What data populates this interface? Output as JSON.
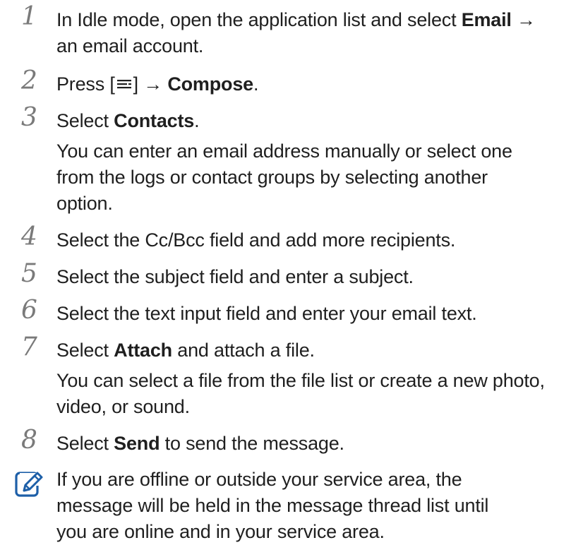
{
  "steps": [
    {
      "number": "1",
      "lines": [
        [
          "In Idle mode, open the application list and select ",
          "Email",
          " →"
        ],
        [
          "an email account."
        ]
      ]
    },
    {
      "number": "2",
      "parts": [
        "Press [",
        "menu-key-icon",
        "] → ",
        "Compose",
        "."
      ]
    },
    {
      "number": "3",
      "title_pre": "Select ",
      "title_bold": "Contacts",
      "title_post": ".",
      "detail": [
        "You can enter an email address manually or select one",
        "from the logs or contact groups by selecting another",
        "option."
      ]
    },
    {
      "number": "4",
      "text": "Select the Cc/Bcc field and add more recipients."
    },
    {
      "number": "5",
      "text": "Select the subject field and enter a subject."
    },
    {
      "number": "6",
      "text": "Select the text input field and enter your email text."
    },
    {
      "number": "7",
      "title_pre": "Select ",
      "title_bold": "Attach",
      "title_post": " and attach a file.",
      "detail": [
        "You can select a file from the file list or create a new photo,",
        "video, or sound."
      ]
    },
    {
      "number": "8",
      "title_pre": "Select ",
      "title_bold": "Send",
      "title_post": " to send the message."
    }
  ],
  "note": {
    "icon": "note-pencil-icon",
    "lines": [
      "If you are offline or outside your service area, the",
      "message will be held in the message thread list until",
      "you are online and in your service area."
    ]
  },
  "colors": {
    "text": "#1f1f1f",
    "step_number": "#7a7a7a",
    "note_icon": "#1d5fa8"
  }
}
